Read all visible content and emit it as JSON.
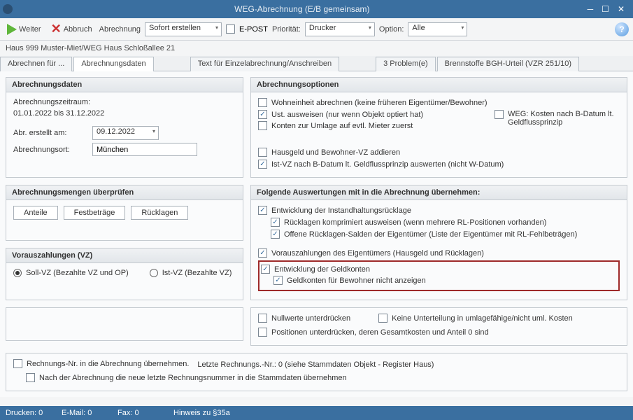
{
  "window": {
    "title": "WEG-Abrechnung (E/B gemeinsam)"
  },
  "toolbar": {
    "weiter": "Weiter",
    "abbruch": "Abbruch",
    "abrechnung_label": "Abrechnung",
    "abrechnung_value": "Sofort erstellen",
    "epost": "E-POST",
    "prioritaet": "Priorität:",
    "drucker": "Drucker",
    "option": "Option:",
    "alle": "Alle"
  },
  "breadcrumb": "Haus 999  Muster-Miet/WEG Haus Schloßallee 21",
  "tabs": {
    "t0": "Abrechnen für ...",
    "t1": "Abrechnungsdaten",
    "t2": "Text für Einzelabrechnung/Anschreiben",
    "t3": "3 Problem(e)",
    "t4": "Brennstoffe BGH-Urteil (VZR 251/10)"
  },
  "panels": {
    "abrechnungsdaten": {
      "title": "Abrechnungsdaten",
      "zeitraum_label": "Abrechnungszeitraum:",
      "zeitraum_value": "01.01.2022 bis 31.12.2022",
      "erstellt_label": "Abr. erstellt am:",
      "erstellt_value": "09.12.2022",
      "ort_label": "Abrechnungsort:",
      "ort_value": "München"
    },
    "mengen": {
      "title": "Abrechnungsmengen überprüfen",
      "anteile": "Anteile",
      "festbetraege": "Festbeträge",
      "ruecklagen": "Rücklagen"
    },
    "vorauszahlungen": {
      "title": "Vorauszahlungen (VZ)",
      "soll": "Soll-VZ (Bezahlte VZ und OP)",
      "ist": "Ist-VZ (Bezahlte VZ)"
    },
    "optionen": {
      "title": "Abrechnungsoptionen",
      "wohneinheit": "Wohneinheit abrechnen (keine früheren Eigentümer/Bewohner)",
      "ust": "Ust. ausweisen (nur wenn Objekt optiert hat)",
      "konten_umlage": "Konten zur Umlage auf evtl. Mieter zuerst",
      "weg_kosten": "WEG: Kosten nach B-Datum lt. Geldflussprinzip",
      "hausgeld_vz": "Hausgeld und Bewohner-VZ addieren",
      "istvz_bdatum": "Ist-VZ nach B-Datum lt. Geldflussprinzip auswerten (nicht W-Datum)"
    },
    "auswertungen": {
      "title": "Folgende Auswertungen mit in die Abrechnung übernehmen:",
      "entwicklung_ruecklage": "Entwicklung der Instandhaltungsrücklage",
      "ruecklagen_komprimiert": "Rücklagen komprimiert ausweisen (wenn mehrere RL-Positionen vorhanden)",
      "offene_salden": "Offene Rücklagen-Salden der Eigentümer (Liste der Eigentümer mit RL-Fehlbeträgen)",
      "vz_eigentuemer": "Vorauszahlungen des Eigentümers (Hausgeld und Rücklagen)",
      "entwicklung_geldkonten": "Entwicklung der Geldkonten",
      "geldkonten_bewohner": "Geldkonten für Bewohner nicht anzeigen"
    },
    "unterdruecken": {
      "nullwerte": "Nullwerte unterdrücken",
      "keine_unterteilung": "Keine Unterteilung in umlagefähige/nicht uml. Kosten",
      "positionen": "Positionen unterdrücken, deren Gesamtkosten und Anteil 0 sind"
    },
    "rechnung": {
      "uebernehmen": "Rechnungs-Nr. in die Abrechnung übernehmen.",
      "letzte_label": "Letzte Rechnungs.-Nr.: 0  (siehe Stammdaten Objekt - Register Haus)",
      "nach": "Nach der Abrechnung die neue letzte Rechnungsnummer in die Stammdaten übernehmen"
    }
  },
  "statusbar": {
    "drucken": "Drucken: 0",
    "email": "E-Mail: 0",
    "fax": "Fax: 0",
    "hinweis": "Hinweis zu §35a"
  }
}
